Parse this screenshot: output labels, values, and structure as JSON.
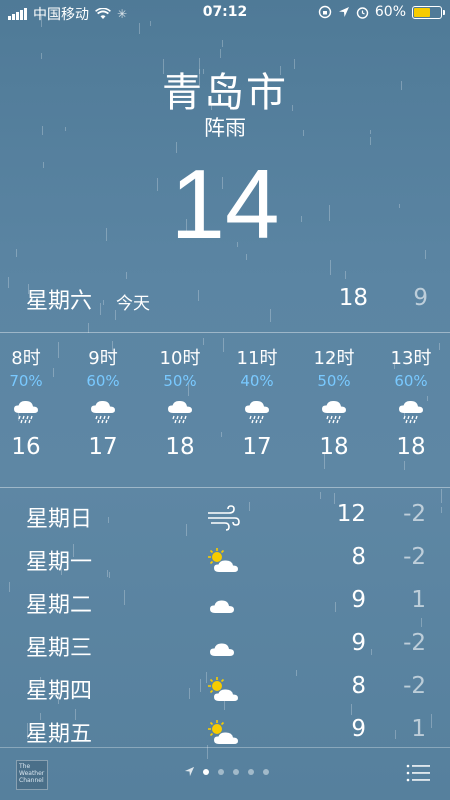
{
  "status_bar": {
    "carrier": "中国移动",
    "time": "07:12",
    "battery_percent": "60%",
    "battery_level": 0.6,
    "battery_color": "#f7cc00"
  },
  "location": {
    "city": "青岛市",
    "condition": "阵雨",
    "temperature": "14"
  },
  "today": {
    "day": "星期六",
    "label": "今天",
    "high": "18",
    "low": "9"
  },
  "hourly": [
    {
      "hour": "8时",
      "precip": "70%",
      "temp": "16",
      "icon": "rain-cloud-icon"
    },
    {
      "hour": "9时",
      "precip": "60%",
      "temp": "17",
      "icon": "rain-cloud-icon"
    },
    {
      "hour": "10时",
      "precip": "50%",
      "temp": "18",
      "icon": "rain-cloud-icon"
    },
    {
      "hour": "11时",
      "precip": "40%",
      "temp": "17",
      "icon": "rain-cloud-icon"
    },
    {
      "hour": "12时",
      "precip": "50%",
      "temp": "18",
      "icon": "rain-cloud-icon"
    },
    {
      "hour": "13时",
      "precip": "60%",
      "temp": "18",
      "icon": "rain-cloud-icon"
    }
  ],
  "daily": [
    {
      "day": "星期日",
      "high": "12",
      "low": "-2",
      "icon": "wind-icon"
    },
    {
      "day": "星期一",
      "high": "8",
      "low": "-2",
      "icon": "partly-sunny-icon"
    },
    {
      "day": "星期二",
      "high": "9",
      "low": "1",
      "icon": "cloud-icon"
    },
    {
      "day": "星期三",
      "high": "9",
      "low": "-2",
      "icon": "cloud-icon"
    },
    {
      "day": "星期四",
      "high": "8",
      "low": "-2",
      "icon": "partly-sunny-icon"
    },
    {
      "day": "星期五",
      "high": "9",
      "low": "1",
      "icon": "partly-sunny-icon"
    }
  ],
  "footer": {
    "logo_text": "The Weather Channel",
    "page_count": 5,
    "active_page": 1
  },
  "colors": {
    "precip_blue": "#79c9ff",
    "background": "#5b85a3"
  }
}
